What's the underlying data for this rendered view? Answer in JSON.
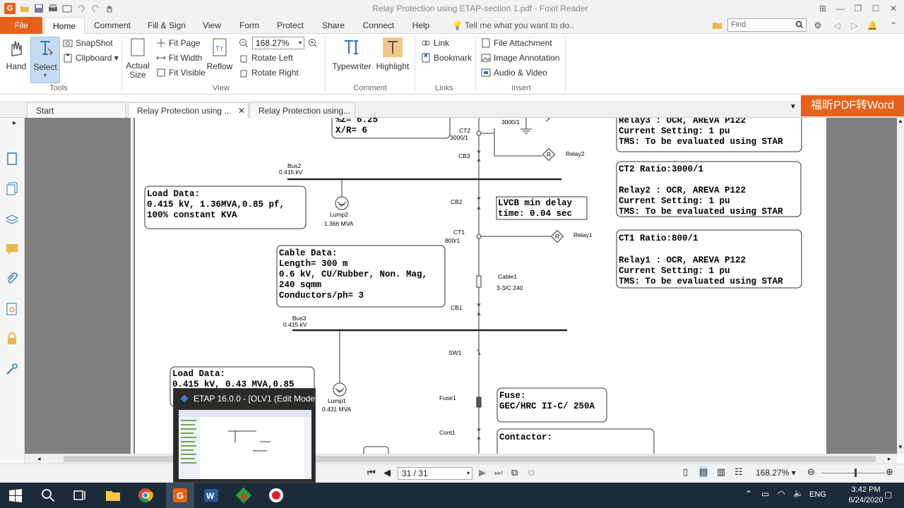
{
  "window": {
    "title": "Relay Protection using ETAP-section 1.pdf - Foxit Reader"
  },
  "ribbon_tabs": [
    "File",
    "Home",
    "Comment",
    "Fill & Sign",
    "View",
    "Form",
    "Protect",
    "Share",
    "Connect",
    "Help"
  ],
  "tell_me": "Tell me what you want to do..",
  "find_placeholder": "Find",
  "tools": {
    "hand": "Hand",
    "select": "Select",
    "snapshot": "SnapShot",
    "clipboard": "Clipboard",
    "label": "Tools"
  },
  "view": {
    "actual_size": "Actual Size",
    "fit_page": "Fit Page",
    "fit_width": "Fit Width",
    "fit_visible": "Fit Visible",
    "reflow": "Reflow",
    "zoom": "168.27%",
    "rotate_left": "Rotate Left",
    "rotate_right": "Rotate Right",
    "label": "View"
  },
  "comment": {
    "typewriter": "Typewriter",
    "highlight": "Highlight",
    "label": "Comment"
  },
  "links": {
    "link": "Link",
    "bookmark": "Bookmark",
    "label": "Links"
  },
  "insert": {
    "file_attachment": "File Attachment",
    "image_annotation": "Image Annotation",
    "audio_video": "Audio & Video",
    "label": "Insert"
  },
  "doc_tabs": [
    "Start",
    "Relay Protection using ...",
    "Relay Protection using..."
  ],
  "ad_banner": "福昕PDF转Word",
  "status": {
    "page": "31 / 31",
    "zoom": "168.27%"
  },
  "taskbar": {
    "lang": "ENG",
    "time": "3:42 PM",
    "date": "6/24/2020"
  },
  "thumbnail": {
    "title": "ETAP 16.0.0 - [OLV1 (Edit Mode)]"
  },
  "diagram": {
    "top_box": [
      "%Z= 6.25",
      "X/R= 6"
    ],
    "ct3_rating": "3000/1",
    "ct2_label": "CT2",
    "ct2_rating": "3000/1",
    "cb3": "CB3",
    "relay2": "Relay2",
    "bus2_name": "Bus2",
    "bus2_kv": "0.415 kV",
    "load2": [
      "Load Data:",
      "0.415 kV, 1.36MVA,0.85 pf,",
      "100% constant KVA"
    ],
    "lump2_name": "Lump2",
    "lump2_mva": "1.366 MVA",
    "cb2": "CB2",
    "lvcb": [
      "LVCB min delay",
      "time: 0.04 sec"
    ],
    "ct1_label": "CT1",
    "ct1_rating": "800/1",
    "relay1": "Relay1",
    "cable": [
      "Cable Data:",
      "Length= 300 m",
      "0.6 kV, CU/Rubber, Non. Mag,",
      "240 sqmm",
      "Conductors/ph= 3"
    ],
    "cable1_name": "Cable1",
    "cable1_spec": "3-3/C 240",
    "cb1": "CB1",
    "bus3_name": "Bus3",
    "bus3_kv": "0.415 kV",
    "sw1": "SW1",
    "load1": [
      "Load Data:",
      "0.415 kV, 0.43 MVA,0.85"
    ],
    "lump1_name": "Lump1",
    "lump1_mva": "0.431 MVA",
    "fuse1": "Fuse1",
    "fuse": [
      "Fuse:",
      "GEC/HRC II-C/ 250A"
    ],
    "cont1": "Cont1",
    "contactor": [
      "Contactor:"
    ],
    "relay3": [
      "Relay3 : OCR, AREVA P122",
      "Current Setting: 1 pu",
      "TMS: To be evaluated using STAR"
    ],
    "relay2_box": [
      "CT2 Ratio:3000/1",
      "",
      "Relay2 : OCR, AREVA P122",
      "Current Setting: 1 pu",
      "TMS: To be evaluated using STAR"
    ],
    "relay1_box": [
      "CT1 Ratio:800/1",
      "",
      "Relay1 : OCR, AREVA P122",
      "Current Setting: 1 pu",
      "TMS: To be evaluated using STAR"
    ]
  },
  "colors": {
    "accent": "#e8611a",
    "taskbar": "#1c2b3a"
  }
}
